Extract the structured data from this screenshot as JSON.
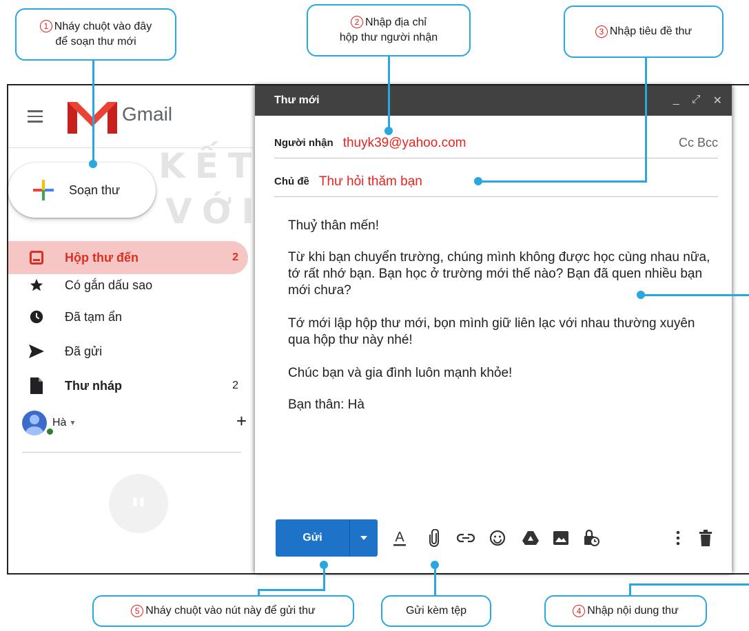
{
  "watermark": {
    "line1": "KẾT NỐI TRI THỨC",
    "line2": "VỚI CUỘC SỐNG"
  },
  "callouts": {
    "c1": {
      "num": "1",
      "line1": "Nháy chuột vào đây",
      "line2": "để soạn thư mới"
    },
    "c2": {
      "num": "2",
      "line1": "Nhập địa chỉ",
      "line2": "hộp thư người nhận"
    },
    "c3": {
      "num": "3",
      "text": "Nhập tiêu đề thư"
    },
    "c4": {
      "num": "4",
      "text": "Nhập nội dung thư"
    },
    "c5": {
      "num": "5",
      "text": "Nháy chuột vào nút này để gửi thư"
    },
    "attach": {
      "text": "Gửi kèm tệp"
    }
  },
  "sidebar": {
    "app_name": "Gmail",
    "compose_label": "Soạn thư",
    "items": [
      {
        "label": "Hộp thư đến",
        "count": "2",
        "icon": "inbox-icon",
        "active": true
      },
      {
        "label": "Có gắn dấu sao",
        "count": "",
        "icon": "star-icon"
      },
      {
        "label": "Đã tạm ẩn",
        "count": "",
        "icon": "clock-icon"
      },
      {
        "label": "Đã gửi",
        "count": "",
        "icon": "send-icon"
      },
      {
        "label": "Thư nháp",
        "count": "2",
        "icon": "draft-icon",
        "bold": true
      }
    ],
    "user": {
      "name": "Hà"
    }
  },
  "compose": {
    "title": "Thư mới",
    "to_label": "Người nhận",
    "to_value": "thuyk39@yahoo.com",
    "cc_bcc": "Cc Bcc",
    "subject_label": "Chủ đề",
    "subject_value": "Thư hỏi thăm bạn",
    "body": {
      "p1": "Thuỷ thân mến!",
      "p2": "Từ khi bạn chuyển trường, chúng mình không được học cùng nhau nữa, tớ rất nhớ bạn. Bạn học ở trường mới thế nào? Bạn đã quen nhiều bạn mới chưa?",
      "p3": "Tớ mới lập hộp thư mới, bọn mình giữ liên lạc với nhau thường xuyên qua hộp thư này nhé!",
      "p4": "Chúc bạn và gia đình luôn mạnh khỏe!",
      "p5": "Bạn thân: Hà"
    },
    "send_label": "Gửi"
  },
  "colors": {
    "accent": "#29a8e0",
    "send_button": "#1c73c7",
    "inbox_active_bg": "#f5c6c3",
    "inbox_active_text": "#d93025",
    "input_text": "#e8231c",
    "header_bg": "#414141"
  }
}
